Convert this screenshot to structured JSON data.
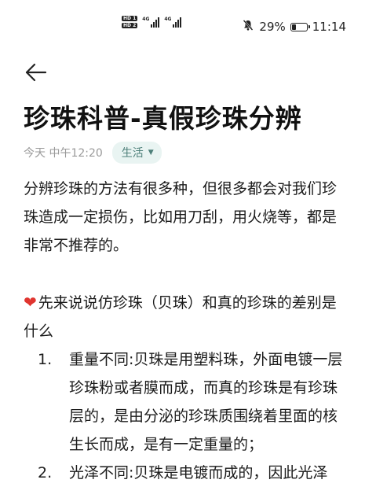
{
  "status_bar": {
    "sim1_badge": "HD 1",
    "sim2_badge": "HD 2",
    "signal1_label": "4G",
    "signal2_label": "4G",
    "mute_icon": "bell-off-icon",
    "battery_percent": "29%",
    "battery_level": 0.29,
    "time": "11:14"
  },
  "nav": {
    "back_icon": "arrow-left-icon"
  },
  "article": {
    "title": "珍珠科普-真假珍珠分辨",
    "date": "今天 中午12:20",
    "tag": "生活",
    "intro": "分辨珍珠的方法有很多种，但很多都会对我们珍珠造成一定损伤，比如用刀刮，用火烧等，都是非常不推荐的。",
    "section_heading": "先来说说仿珍珠（贝珠）和真的珍珠的差别是什么",
    "heading_icon": "red-heart-icon",
    "list_items": [
      {
        "num": "1.",
        "text": "重量不同:贝珠是用塑料珠，外面电镀一层珍珠粉或者膜而成，而真的珍珠是有珍珠层的，是由分泌的珍珠质围绕着里面的核生长而成，是有一定重量的；"
      },
      {
        "num": "2.",
        "text": "光泽不同:贝珠是电镀而成的，因此光泽"
      }
    ]
  }
}
